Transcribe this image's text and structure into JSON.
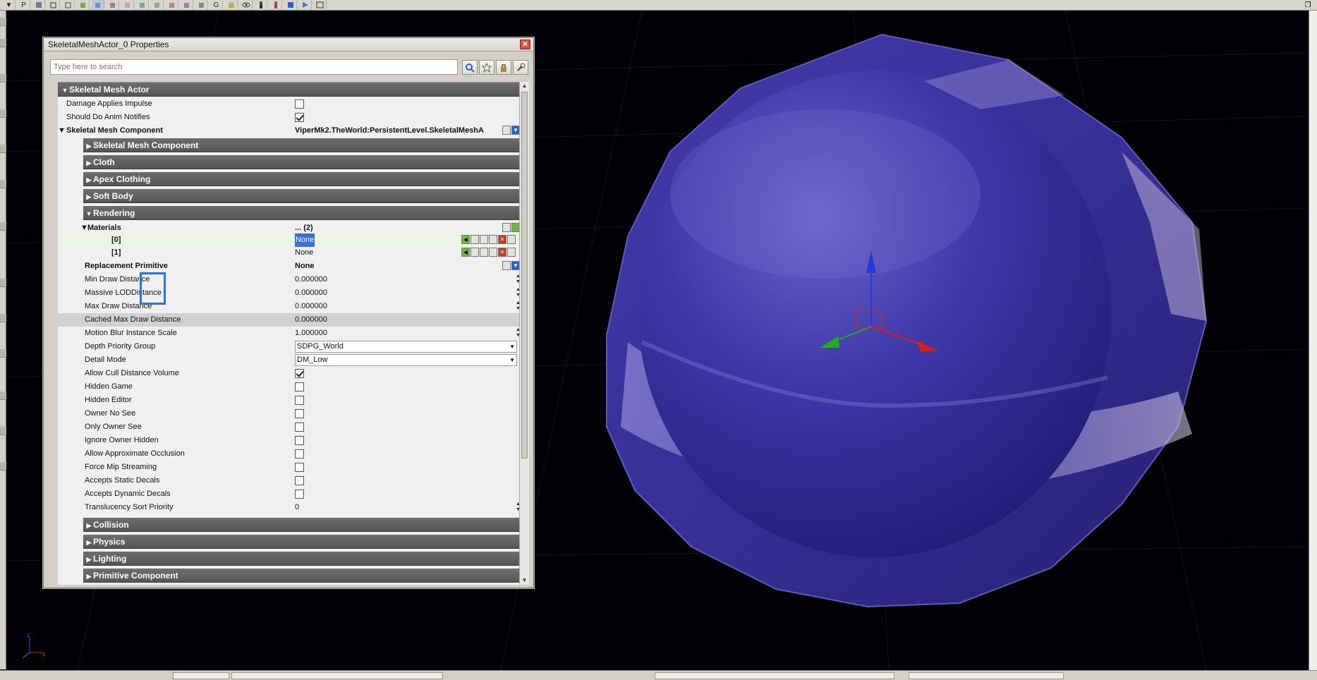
{
  "toolbar": {
    "items": [
      "menu-arrow",
      "P",
      "actor",
      "cube1",
      "cube2",
      "cube3",
      "cube4",
      "cube5",
      "cube6",
      "cube7",
      "cube8",
      "cube9",
      "cube10",
      "cube11",
      "G",
      "lock",
      "eye",
      "figure",
      "figure-red",
      "blue-box",
      "play",
      "window"
    ],
    "letters": {
      "p": "P",
      "g": "G"
    }
  },
  "window": {
    "title": "SkeletalMeshActor_0 Properties",
    "close_symbol": "✕"
  },
  "search": {
    "placeholder": "Type here to search"
  },
  "categories": {
    "skeletal_mesh_actor": "Skeletal Mesh Actor",
    "skeletal_mesh_component_sub": "Skeletal Mesh Component",
    "cloth": "Cloth",
    "apex_clothing": "Apex Clothing",
    "soft_body": "Soft Body",
    "rendering": "Rendering",
    "collision": "Collision",
    "physics": "Physics",
    "lighting": "Lighting",
    "primitive_component": "Primitive Component"
  },
  "props": {
    "damage_applies_impulse": {
      "label": "Damage Applies Impulse",
      "checked": false
    },
    "should_do_anim_notifies": {
      "label": "Should Do Anim Notifies",
      "checked": true
    },
    "skeletal_mesh_component": {
      "label": "Skeletal Mesh Component",
      "value": "ViperMk2.TheWorld:PersistentLevel.SkeletalMeshA"
    },
    "materials": {
      "label": "Materials",
      "value": "... (2)"
    },
    "mat0": {
      "label": "[0]",
      "value": "None"
    },
    "mat1": {
      "label": "[1]",
      "value": "None"
    },
    "replacement_primitive": {
      "label": "Replacement Primitive",
      "value": "None"
    },
    "min_draw_distance": {
      "label": "Min Draw Distance",
      "value": "0.000000"
    },
    "massive_lod_distance": {
      "label": "Massive LODDistance",
      "value": "0.000000"
    },
    "max_draw_distance": {
      "label": "Max Draw Distance",
      "value": "0.000000"
    },
    "cached_max_draw_distance": {
      "label": "Cached Max Draw Distance",
      "value": "0.000000"
    },
    "motion_blur_instance_scale": {
      "label": "Motion Blur Instance Scale",
      "value": "1.000000"
    },
    "depth_priority_group": {
      "label": "Depth Priority Group",
      "value": "SDPG_World"
    },
    "detail_mode": {
      "label": "Detail Mode",
      "value": "DM_Low"
    },
    "allow_cull_distance_volume": {
      "label": "Allow Cull Distance Volume",
      "checked": true
    },
    "hidden_game": {
      "label": "Hidden Game",
      "checked": false
    },
    "hidden_editor": {
      "label": "Hidden Editor",
      "checked": false
    },
    "owner_no_see": {
      "label": "Owner No See",
      "checked": false
    },
    "only_owner_see": {
      "label": "Only Owner See",
      "checked": false
    },
    "ignore_owner_hidden": {
      "label": "Ignore Owner Hidden",
      "checked": false
    },
    "allow_approximate_occlusion": {
      "label": "Allow Approximate Occlusion",
      "checked": false
    },
    "force_mip_streaming": {
      "label": "Force Mip Streaming",
      "checked": false
    },
    "accepts_static_decals": {
      "label": "Accepts Static Decals",
      "checked": false
    },
    "accepts_dynamic_decals": {
      "label": "Accepts Dynamic Decals",
      "checked": false
    },
    "translucency_sort_priority": {
      "label": "Translucency Sort Priority",
      "value": "0"
    }
  },
  "viewport": {
    "axis_labels": {
      "z": "z",
      "x": "x"
    },
    "colors": {
      "sphere": "#3b35a8",
      "shell": "#5a4fc4",
      "grid": "#1a1a2a"
    }
  }
}
